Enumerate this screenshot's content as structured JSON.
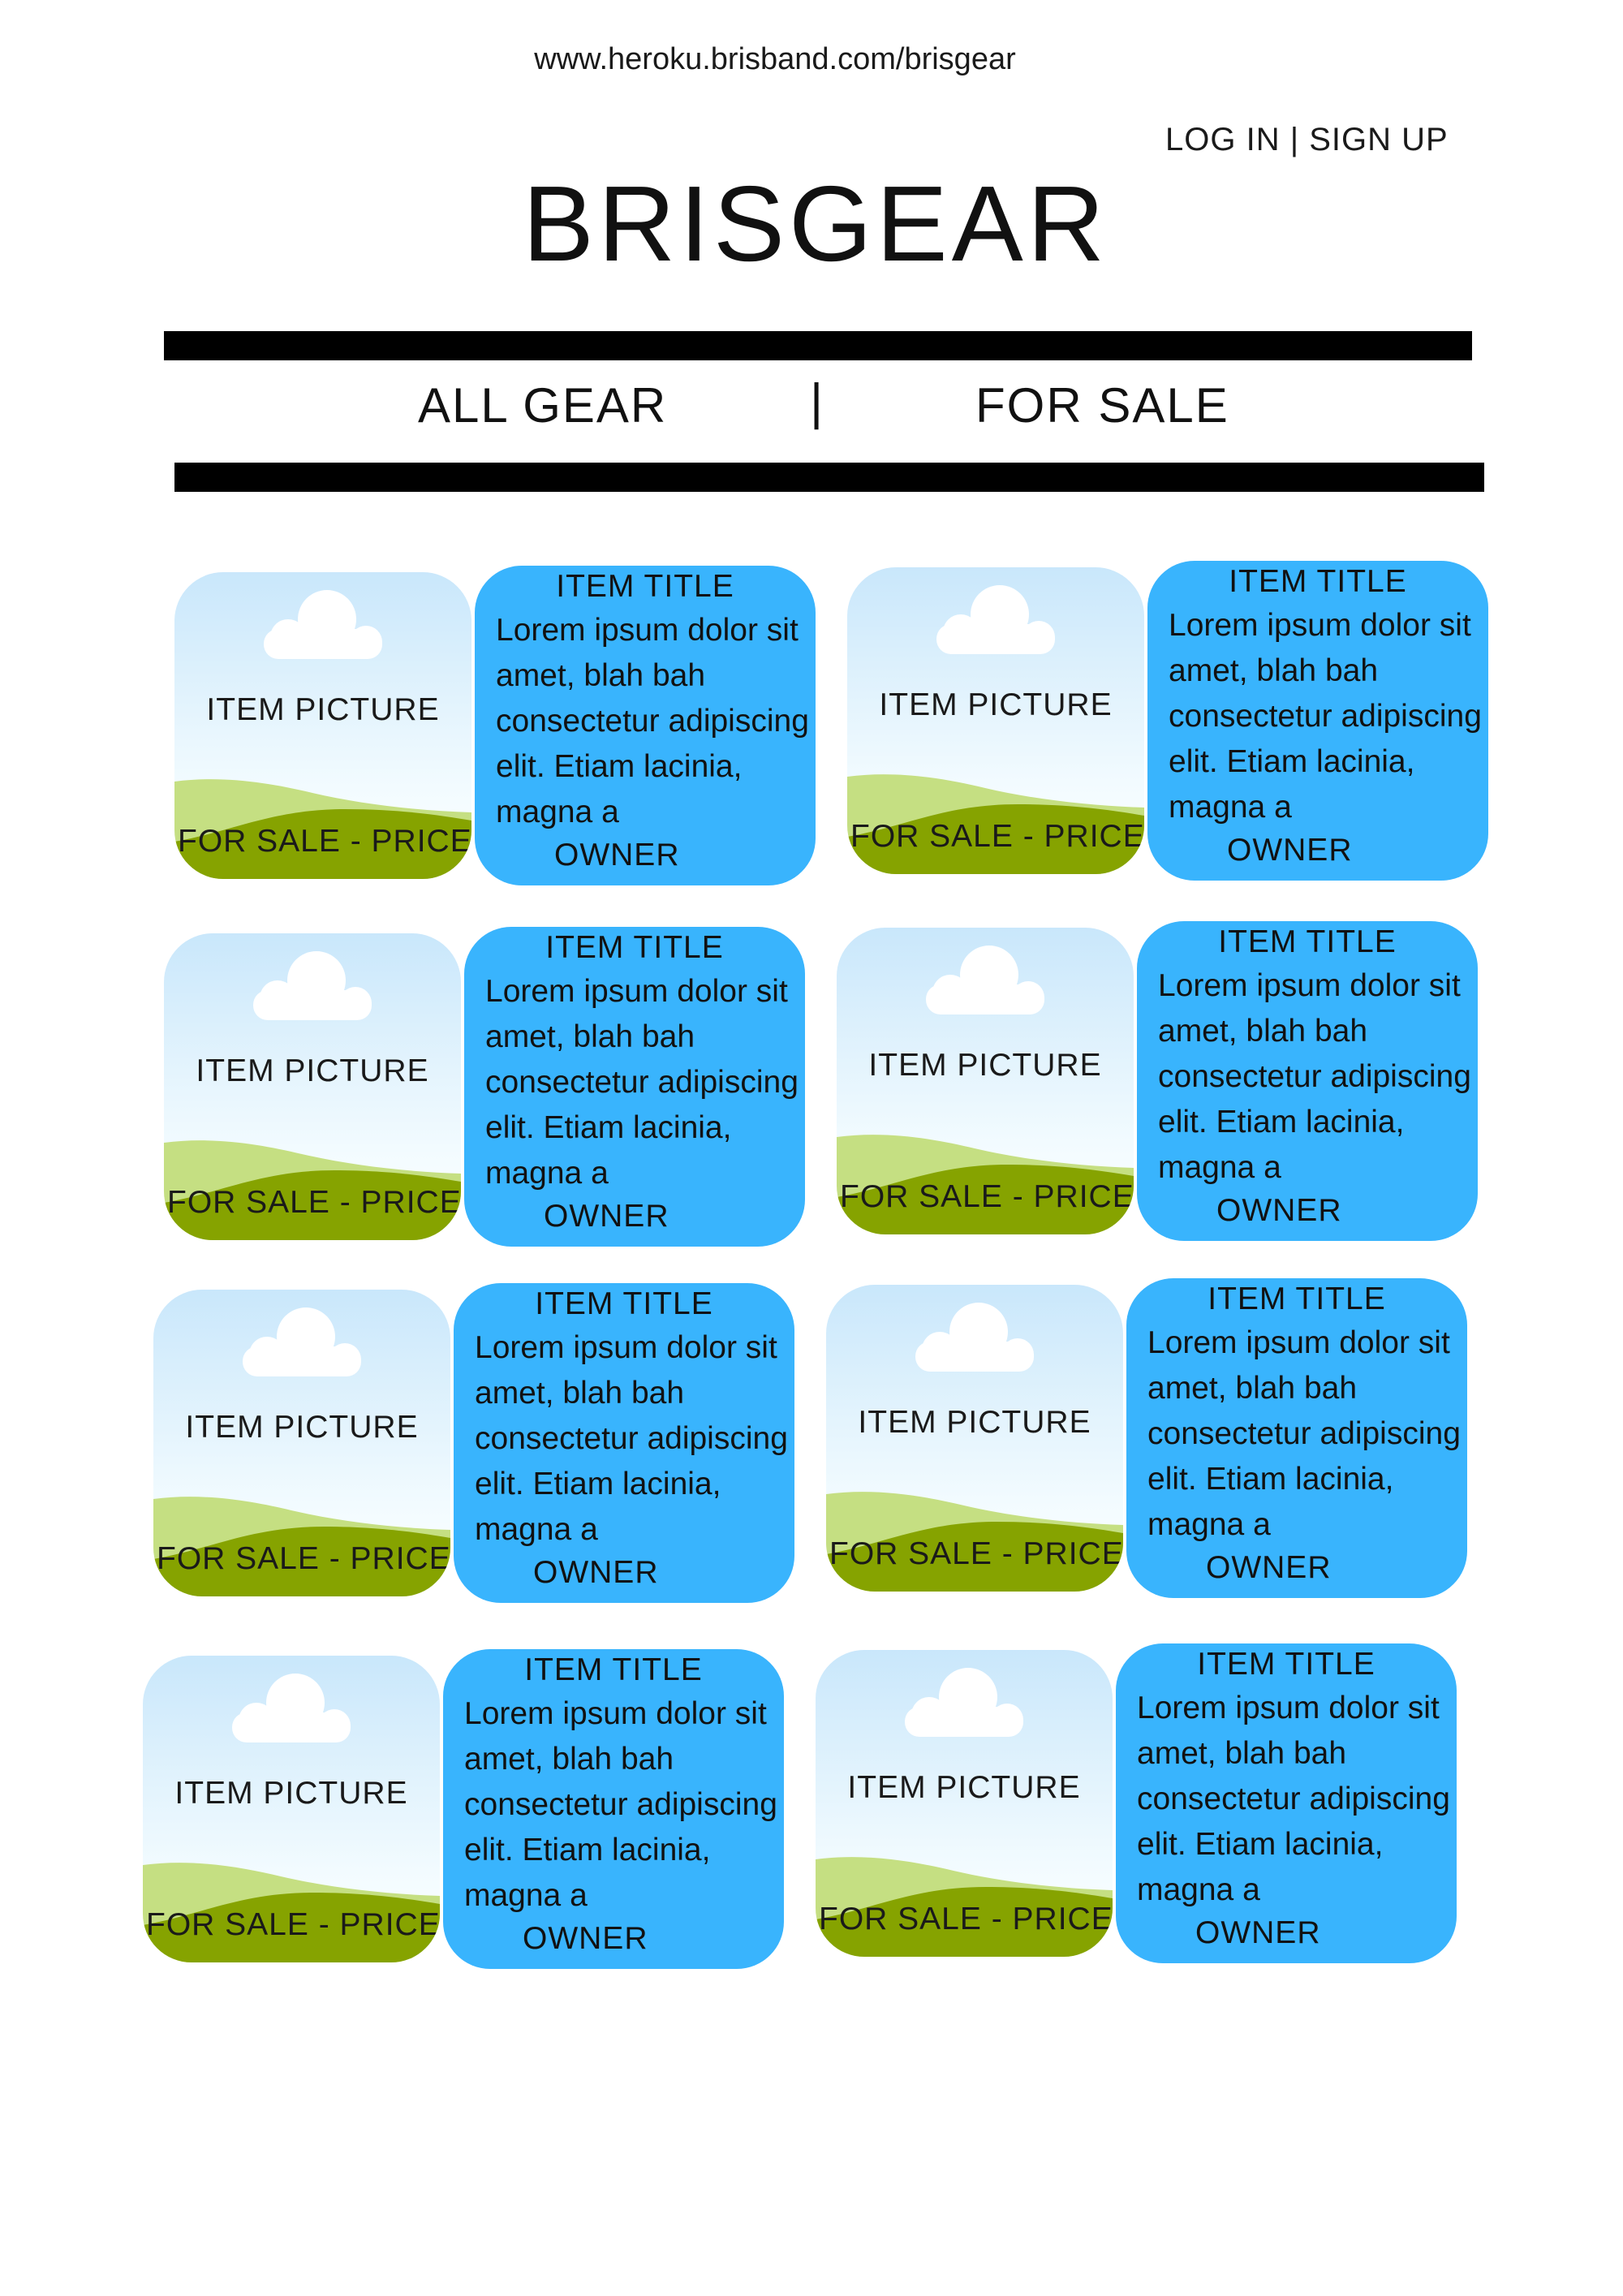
{
  "browser": {
    "url": "www.heroku.brisband.com/brisgear"
  },
  "header": {
    "login_label": "LOG IN",
    "separator": " | ",
    "signup_label": "SIGN UP",
    "site_title": "BRISGEAR"
  },
  "nav": {
    "all_gear": "ALL GEAR",
    "divider": "|",
    "for_sale": "FOR SALE"
  },
  "colors": {
    "card_blue": "#39b4fd",
    "hill_light": "#c5df82",
    "hill_dark": "#86a300",
    "bar": "#000000"
  },
  "items": [
    {
      "picture": "ITEM PICTURE",
      "price": "FOR SALE - PRICE",
      "title": "ITEM TITLE",
      "description": "Lorem ipsum dolor sit amet, blah bah consectetur adipiscing elit. Etiam lacinia, magna a",
      "owner": "OWNER"
    },
    {
      "picture": "ITEM PICTURE",
      "price": "FOR SALE - PRICE",
      "title": "ITEM TITLE",
      "description": "Lorem ipsum dolor sit amet, blah bah consectetur adipiscing elit. Etiam lacinia, magna a",
      "owner": "OWNER"
    },
    {
      "picture": "ITEM PICTURE",
      "price": "FOR SALE - PRICE",
      "title": "ITEM TITLE",
      "description": "Lorem ipsum dolor sit amet, blah bah consectetur adipiscing elit. Etiam lacinia, magna a",
      "owner": "OWNER"
    },
    {
      "picture": "ITEM PICTURE",
      "price": "FOR SALE - PRICE",
      "title": "ITEM TITLE",
      "description": "Lorem ipsum dolor sit amet, blah bah consectetur adipiscing elit. Etiam lacinia, magna a",
      "owner": "OWNER"
    },
    {
      "picture": "ITEM PICTURE",
      "price": "FOR SALE - PRICE",
      "title": "ITEM TITLE",
      "description": "Lorem ipsum dolor sit amet, blah bah consectetur adipiscing elit. Etiam lacinia, magna a",
      "owner": "OWNER"
    },
    {
      "picture": "ITEM PICTURE",
      "price": "FOR SALE - PRICE",
      "title": "ITEM TITLE",
      "description": "Lorem ipsum dolor sit amet, blah bah consectetur adipiscing elit. Etiam lacinia, magna a",
      "owner": "OWNER"
    },
    {
      "picture": "ITEM PICTURE",
      "price": "FOR SALE - PRICE",
      "title": "ITEM TITLE",
      "description": "Lorem ipsum dolor sit amet, blah bah consectetur adipiscing elit. Etiam lacinia, magna a",
      "owner": "OWNER"
    },
    {
      "picture": "ITEM PICTURE",
      "price": "FOR SALE - PRICE",
      "title": "ITEM TITLE",
      "description": "Lorem ipsum dolor sit amet, blah bah consectetur adipiscing elit. Etiam lacinia, magna a",
      "owner": "OWNER"
    }
  ]
}
